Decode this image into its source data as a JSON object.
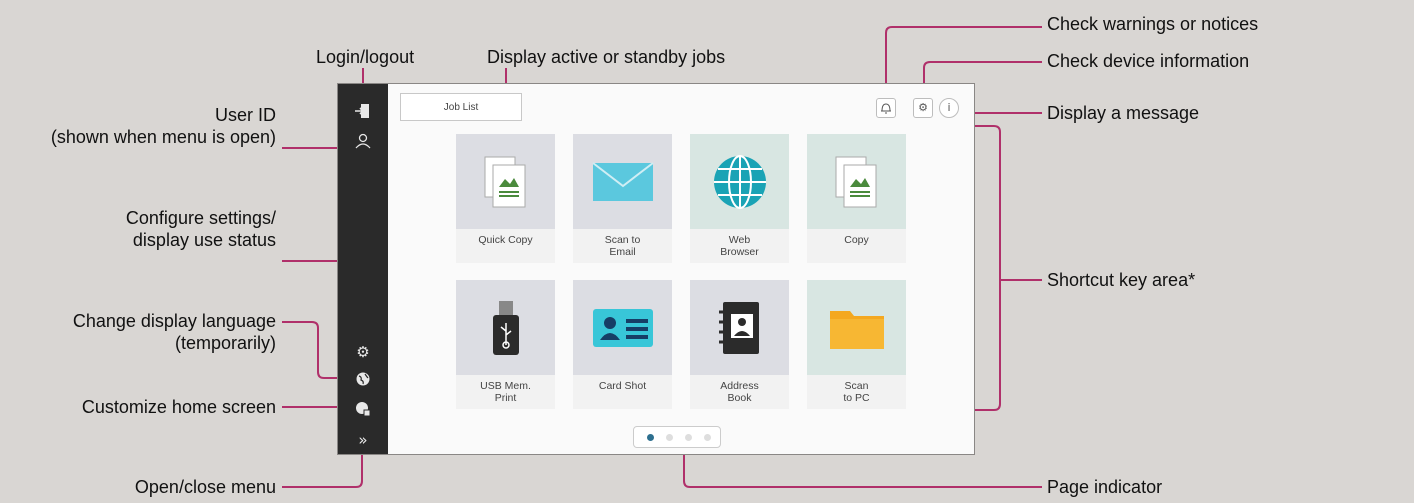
{
  "callouts": {
    "login_logout": "Login/logout",
    "active_jobs": "Display active or standby jobs",
    "user_id_line1": "User ID",
    "user_id_line2": "(shown when menu is open)",
    "settings_line1": "Configure settings/",
    "settings_line2": "display use status",
    "language_line1": "Change display language",
    "language_line2": "(temporarily)",
    "customize_home": "Customize home screen",
    "open_close_menu": "Open/close menu",
    "warnings": "Check warnings or notices",
    "device_info": "Check device information",
    "message": "Display a message",
    "shortcut_area": "Shortcut key area*",
    "page_indicator": "Page indicator"
  },
  "screen": {
    "job_list": "Job List",
    "tiles": [
      {
        "line1": "Quick Copy",
        "line2": "",
        "icon": "copy-icon",
        "bg": "#dcdde3"
      },
      {
        "line1": "Scan to",
        "line2": "Email",
        "icon": "email-icon",
        "bg": "#dcdde3"
      },
      {
        "line1": "Web",
        "line2": "Browser",
        "icon": "globe-icon",
        "bg": "#d8e6e2"
      },
      {
        "line1": "Copy",
        "line2": "",
        "icon": "copy-icon",
        "bg": "#d8e6e2"
      },
      {
        "line1": "USB Mem.",
        "line2": "Print",
        "icon": "usb-icon",
        "bg": "#dcdde3"
      },
      {
        "line1": "Card Shot",
        "line2": "",
        "icon": "id-card-icon",
        "bg": "#dcdde3"
      },
      {
        "line1": "Address",
        "line2": "Book",
        "icon": "address-book-icon",
        "bg": "#dcdde3"
      },
      {
        "line1": "Scan",
        "line2": "to PC",
        "icon": "folder-icon",
        "bg": "#d8e6e2"
      }
    ],
    "page_indicator": {
      "pages": 4,
      "current": 1
    }
  },
  "colors": {
    "leader": "#b0306a",
    "background": "#d9d6d3",
    "sidebar": "#2a2a2a"
  }
}
